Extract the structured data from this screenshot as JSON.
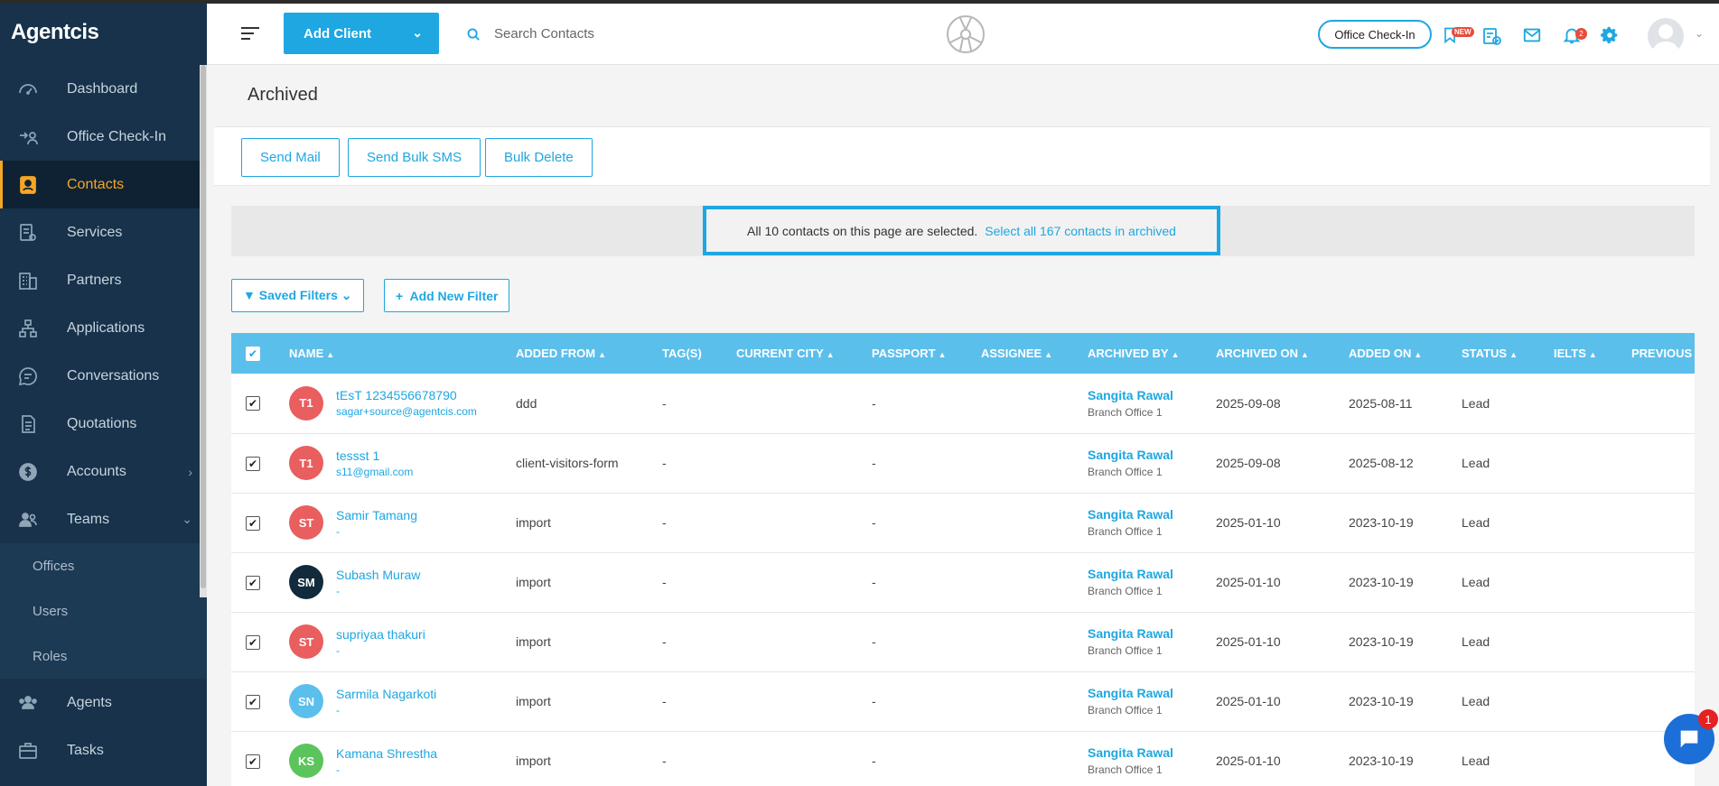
{
  "brand": "Agentcis",
  "sidebar": {
    "items": [
      {
        "label": "Dashboard",
        "icon": "gauge-icon"
      },
      {
        "label": "Office Check-In",
        "icon": "checkin-icon"
      },
      {
        "label": "Contacts",
        "icon": "contact-card-icon"
      },
      {
        "label": "Services",
        "icon": "services-icon"
      },
      {
        "label": "Partners",
        "icon": "building-icon"
      },
      {
        "label": "Applications",
        "icon": "flow-icon"
      },
      {
        "label": "Conversations",
        "icon": "chat-icon"
      },
      {
        "label": "Quotations",
        "icon": "document-icon"
      },
      {
        "label": "Accounts",
        "icon": "dollar-icon"
      },
      {
        "label": "Teams",
        "icon": "team-icon"
      }
    ],
    "team_sub": [
      "Offices",
      "Users",
      "Roles"
    ],
    "items_after": [
      {
        "label": "Agents",
        "icon": "agents-icon"
      },
      {
        "label": "Tasks",
        "icon": "briefcase-icon"
      }
    ]
  },
  "header": {
    "add_client": "Add Client",
    "search_placeholder": "Search Contacts",
    "office_checkin": "Office Check-In",
    "new_badge": "NEW",
    "notif_count": "2"
  },
  "page": {
    "title": "Archived",
    "actions": [
      "Send Mail",
      "Send Bulk SMS",
      "Bulk Delete"
    ],
    "selection_text": "All 10 contacts on this page are selected.",
    "selection_link": "Select all 167 contacts in archived",
    "saved_filters": "Saved Filters",
    "add_filter": "Add New Filter"
  },
  "table": {
    "columns": [
      "NAME",
      "ADDED FROM",
      "TAG(S)",
      "CURRENT CITY",
      "PASSPORT",
      "ASSIGNEE",
      "ARCHIVED BY",
      "ARCHIVED ON",
      "ADDED ON",
      "STATUS",
      "IELTS",
      "PREVIOUS"
    ],
    "rows": [
      {
        "initials": "T1",
        "color": "#e95e5e",
        "name": "tEsT 1234556678790",
        "email": "sagar+source@agentcis.com",
        "added_from": "ddd",
        "tags": "-",
        "city": "",
        "passport": "-",
        "assignee": "",
        "archived_by": "Sangita Rawal",
        "office": "Branch Office 1",
        "archived_on": "2025-09-08",
        "added_on": "2025-08-11",
        "status": "Lead"
      },
      {
        "initials": "T1",
        "color": "#e95e5e",
        "name": "tessst 1",
        "email": "s11@gmail.com",
        "added_from": "client-visitors-form",
        "tags": "-",
        "city": "",
        "passport": "-",
        "assignee": "",
        "archived_by": "Sangita Rawal",
        "office": "Branch Office 1",
        "archived_on": "2025-09-08",
        "added_on": "2025-08-12",
        "status": "Lead"
      },
      {
        "initials": "ST",
        "color": "#e95e5e",
        "name": "Samir Tamang",
        "email": "-",
        "added_from": "import",
        "tags": "-",
        "city": "",
        "passport": "-",
        "assignee": "",
        "archived_by": "Sangita Rawal",
        "office": "Branch Office 1",
        "archived_on": "2025-01-10",
        "added_on": "2023-10-19",
        "status": "Lead"
      },
      {
        "initials": "SM",
        "color": "#112a3c",
        "name": "Subash Muraw",
        "email": "-",
        "added_from": "import",
        "tags": "-",
        "city": "",
        "passport": "-",
        "assignee": "",
        "archived_by": "Sangita Rawal",
        "office": "Branch Office 1",
        "archived_on": "2025-01-10",
        "added_on": "2023-10-19",
        "status": "Lead"
      },
      {
        "initials": "ST",
        "color": "#e95e5e",
        "name": "supriyaa thakuri",
        "email": "-",
        "added_from": "import",
        "tags": "-",
        "city": "",
        "passport": "-",
        "assignee": "",
        "archived_by": "Sangita Rawal",
        "office": "Branch Office 1",
        "archived_on": "2025-01-10",
        "added_on": "2023-10-19",
        "status": "Lead"
      },
      {
        "initials": "SN",
        "color": "#5bbfec",
        "name": "Sarmila Nagarkoti",
        "email": "-",
        "added_from": "import",
        "tags": "-",
        "city": "",
        "passport": "-",
        "assignee": "",
        "archived_by": "Sangita Rawal",
        "office": "Branch Office 1",
        "archived_on": "2025-01-10",
        "added_on": "2023-10-19",
        "status": "Lead"
      },
      {
        "initials": "KS",
        "color": "#5cc45c",
        "name": "Kamana Shrestha",
        "email": "-",
        "added_from": "import",
        "tags": "-",
        "city": "",
        "passport": "-",
        "assignee": "",
        "archived_by": "Sangita Rawal",
        "office": "Branch Office 1",
        "archived_on": "2025-01-10",
        "added_on": "2023-10-19",
        "status": "Lead"
      }
    ]
  },
  "chat_badge": "1"
}
